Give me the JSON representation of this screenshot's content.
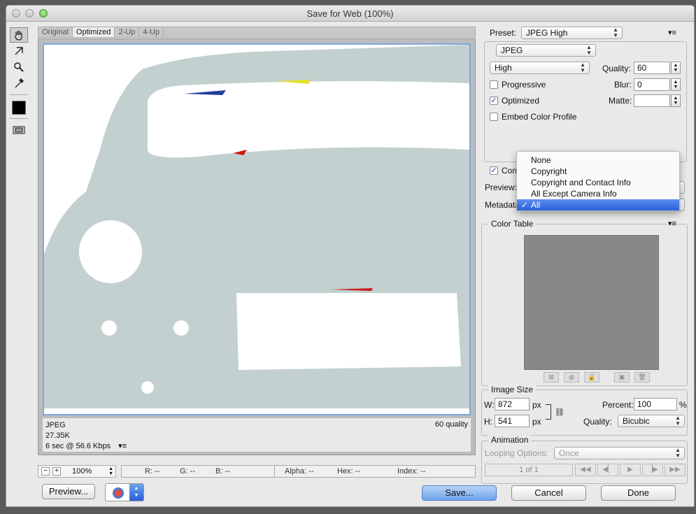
{
  "window": {
    "title": "Save for Web (100%)"
  },
  "tabs": [
    "Original",
    "Optimized",
    "2-Up",
    "4-Up"
  ],
  "image_info": {
    "format": "JPEG",
    "size": "27.35K",
    "download": "6 sec @ 56.6 Kbps",
    "quality": "60 quality"
  },
  "zoom": {
    "value": "100%",
    "minus": "−",
    "plus": "+"
  },
  "status": {
    "r": "R: --",
    "g": "G: --",
    "b": "B: --",
    "alpha": "Alpha: --",
    "hex": "Hex: --",
    "index": "Index: --"
  },
  "buttons": {
    "preview": "Preview...",
    "save": "Save...",
    "cancel": "Cancel",
    "done": "Done"
  },
  "settings": {
    "preset_label": "Preset:",
    "preset_value": "JPEG High",
    "format": "JPEG",
    "compression": "High",
    "quality_label": "Quality:",
    "quality_value": "60",
    "progressive_label": "Progressive",
    "blur_label": "Blur:",
    "blur_value": "0",
    "optimized_label": "Optimized",
    "matte_label": "Matte:",
    "matte_value": "",
    "embed_label": "Embed Color Profile",
    "convert_label": "Conv",
    "preview_label": "Preview:",
    "metadata_label": "Metadata"
  },
  "checkboxes": {
    "progressive": false,
    "optimized": true,
    "embed": false,
    "convert": true
  },
  "metadata_menu": {
    "items": [
      "None",
      "Copyright",
      "Copyright and Contact Info",
      "All Except Camera Info",
      "All"
    ],
    "selected": "All",
    "check": "✓"
  },
  "color_table": {
    "title": "Color Table"
  },
  "image_size": {
    "title": "Image Size",
    "w_label": "W:",
    "w_value": "872",
    "w_unit": "px",
    "h_label": "H:",
    "h_value": "541",
    "h_unit": "px",
    "percent_label": "Percent:",
    "percent_value": "100",
    "percent_unit": "%",
    "quality_label": "Quality:",
    "quality_value": "Bicubic"
  },
  "animation": {
    "title": "Animation",
    "looping_label": "Looping Options:",
    "looping_value": "Once",
    "frame": "1 of 1"
  },
  "colors": {
    "accent": "#2a5fd8",
    "car_body": "#c3d0d0",
    "color_table_bg": "#888888"
  }
}
